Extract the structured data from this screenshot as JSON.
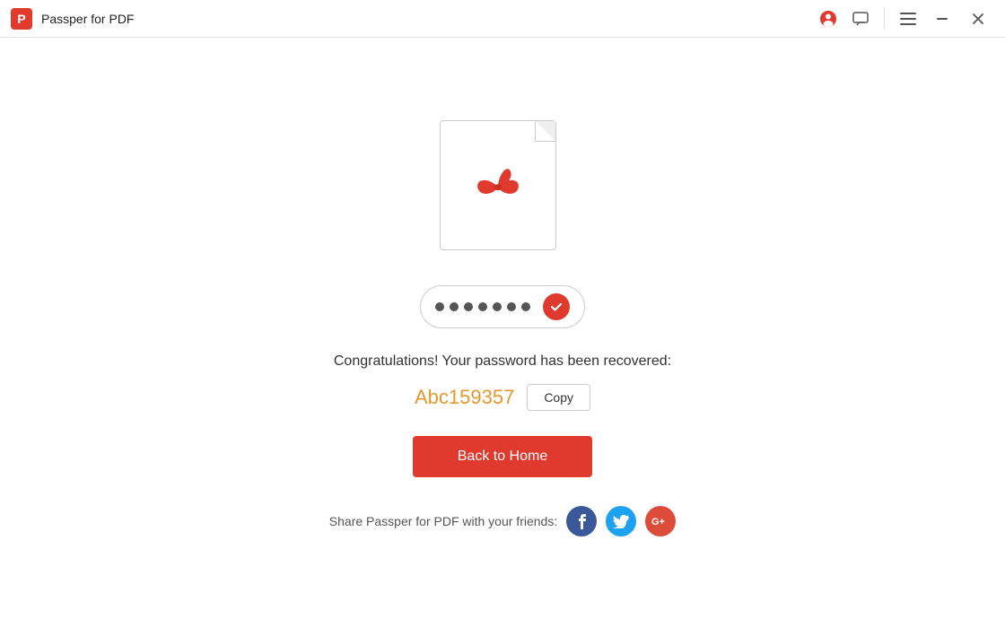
{
  "app": {
    "title": "Passper for PDF",
    "logo_letter": "P"
  },
  "titlebar": {
    "profile_icon": "👤",
    "chat_icon": "💬",
    "menu_icon": "☰",
    "minimize_icon": "—",
    "close_icon": "✕"
  },
  "main": {
    "congrats_text": "Congratulations! Your password has been recovered:",
    "password_value": "Abc159357",
    "copy_label": "Copy",
    "back_home_label": "Back to Home",
    "share_text": "Share Passper for PDF with your friends:",
    "dots_count": 7
  },
  "social": {
    "facebook_label": "f",
    "twitter_label": "t",
    "google_label": "G+"
  }
}
